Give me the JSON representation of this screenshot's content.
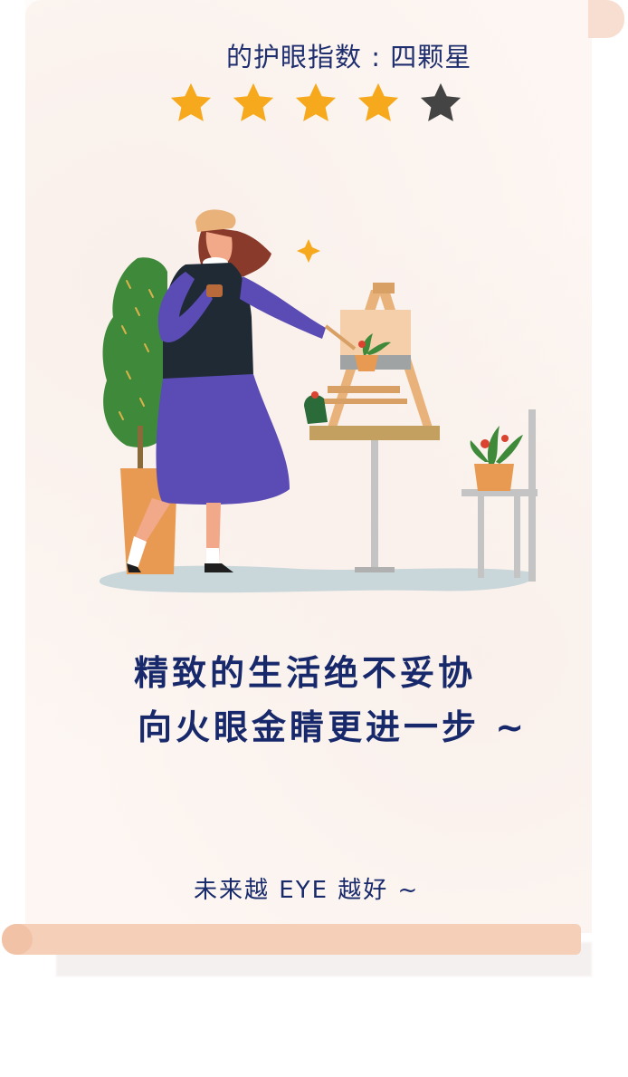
{
  "rating": {
    "label": "的护眼指数 : 四颗星",
    "stars_total": 5,
    "stars_filled": 4,
    "filled_color": "#f6a91c",
    "empty_color": "#444444"
  },
  "slogan": {
    "line1": "精致的生活绝不妥协",
    "line2": "向火眼金睛更进一步 ~"
  },
  "footer": {
    "text": "未来越 EYE 越好 ~"
  },
  "icons": [
    "star-icon",
    "sparkle-icon"
  ],
  "colors": {
    "paper": "#fdf6f2",
    "roll": "#f5cfb8",
    "text": "#17296b",
    "dress": "#5b4bb5",
    "tree": "#3f8a3a",
    "pot": "#e89a52"
  }
}
